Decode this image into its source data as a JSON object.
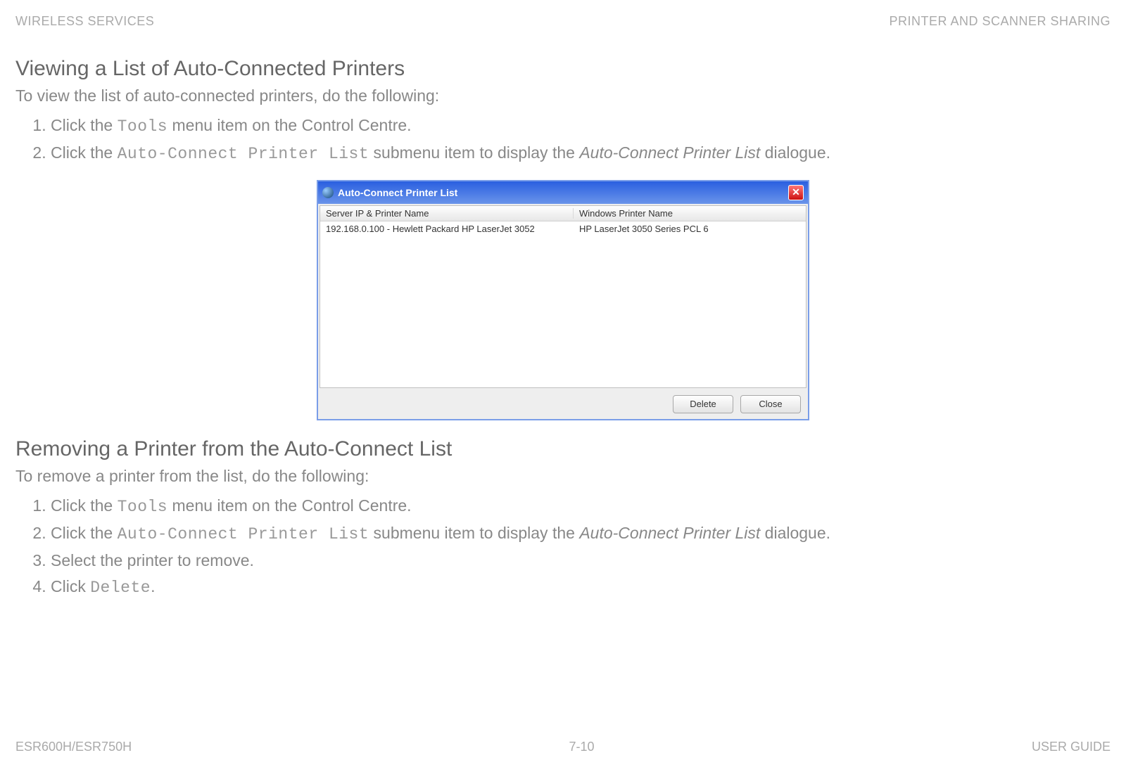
{
  "header": {
    "left": "WIRELESS SERVICES",
    "right": "PRINTER AND SCANNER SHARING"
  },
  "section1": {
    "heading": "Viewing a List of Auto-Connected Printers",
    "intro": "To view the list of auto-connected printers, do the following:",
    "steps": [
      {
        "pre": "Click the ",
        "mono": "Tools",
        "post": " menu item on the Control Centre."
      },
      {
        "pre": "Click the ",
        "mono": "Auto-Connect Printer List",
        "post": " submenu item to display the ",
        "ital": "Auto-Connect Printer List",
        "tail": " dialogue."
      }
    ]
  },
  "dialog": {
    "title": "Auto-Connect Printer List",
    "col1_header": "Server IP & Printer Name",
    "col2_header": "Windows Printer Name",
    "row1_col1": "192.168.0.100 - Hewlett Packard HP LaserJet 3052",
    "row1_col2": "HP LaserJet 3050 Series PCL 6",
    "btn_delete": "Delete",
    "btn_close": "Close"
  },
  "section2": {
    "heading": "Removing a Printer from the Auto-Connect List",
    "intro": "To remove a printer from the list, do the following:",
    "steps": [
      {
        "pre": "Click the ",
        "mono": "Tools",
        "post": " menu item on the Control Centre."
      },
      {
        "pre": "Click the ",
        "mono": "Auto-Connect Printer List",
        "post": " submenu item to display the ",
        "ital": "Auto-Connect Printer List",
        "tail": " dialogue."
      },
      {
        "pre": "Select the printer to remove."
      },
      {
        "pre": "Click ",
        "mono": "Delete",
        "post": "."
      }
    ]
  },
  "footer": {
    "left": "ESR600H/ESR750H",
    "center": "7-10",
    "right": "USER GUIDE"
  }
}
